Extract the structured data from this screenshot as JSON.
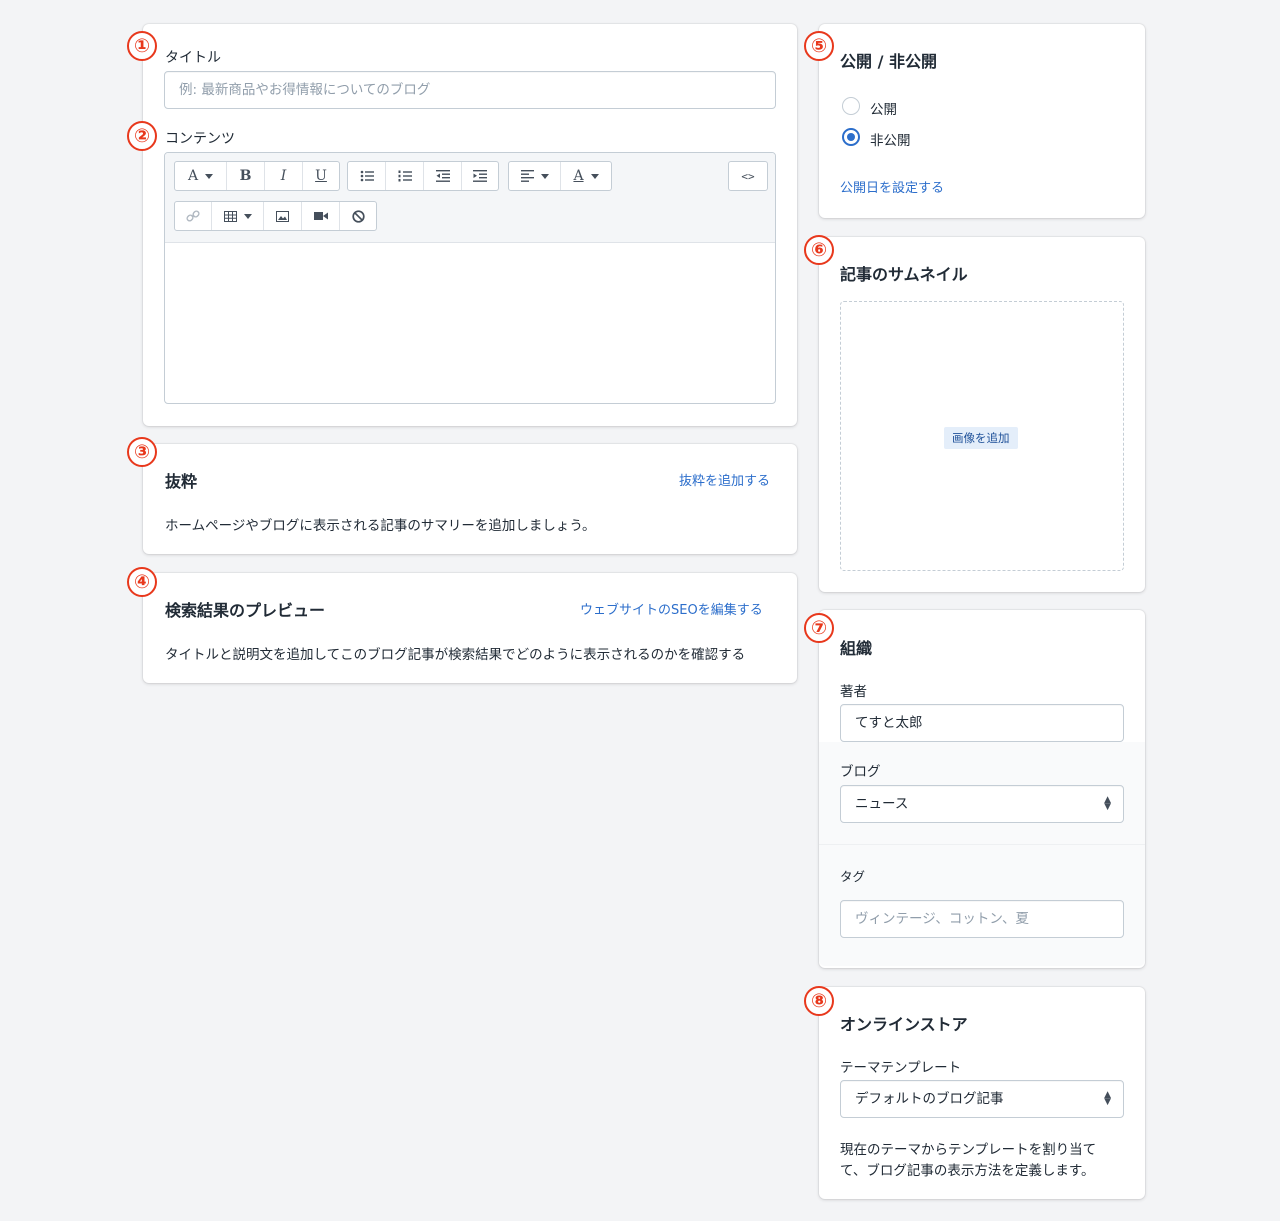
{
  "markers": [
    "①",
    "②",
    "③",
    "④",
    "⑤",
    "⑥",
    "⑦",
    "⑧"
  ],
  "title_card": {
    "title_label": "タイトル",
    "title_placeholder": "例: 最新商品やお得情報についてのブログ",
    "content_label": "コンテンツ",
    "toolbar": {
      "font": "A",
      "bold": "B",
      "italic": "I",
      "underline": "U",
      "text_color": "A",
      "html": "<>"
    }
  },
  "excerpt": {
    "heading": "抜粋",
    "link": "抜粋を追加する",
    "description": "ホームページやブログに表示される記事のサマリーを追加しましょう。"
  },
  "seo": {
    "heading": "検索結果のプレビュー",
    "link": "ウェブサイトのSEOを編集する",
    "description": "タイトルと説明文を追加してこのブログ記事が検索結果でどのように表示されるのかを確認する"
  },
  "visibility": {
    "heading": "公開 / 非公開",
    "options": [
      "公開",
      "非公開"
    ],
    "selected": "非公開",
    "link": "公開日を設定する"
  },
  "thumbnail": {
    "heading": "記事のサムネイル",
    "button": "画像を追加"
  },
  "organization": {
    "heading": "組織",
    "author_label": "著者",
    "author_value": "てすと太郎",
    "blog_label": "ブログ",
    "blog_value": "ニュース",
    "tags_label": "タグ",
    "tags_placeholder": "ヴィンテージ、コットン、夏"
  },
  "online_store": {
    "heading": "オンラインストア",
    "template_label": "テーマテンプレート",
    "template_value": "デフォルトのブログ記事",
    "description_line1": "現在のテーマからテンプレートを割り当て",
    "description_line2": "て、ブログ記事の表示方法を定義します。"
  },
  "colors": {
    "marker": "#e8381c",
    "link": "#2c6ecb",
    "background": "#f3f4f6"
  }
}
